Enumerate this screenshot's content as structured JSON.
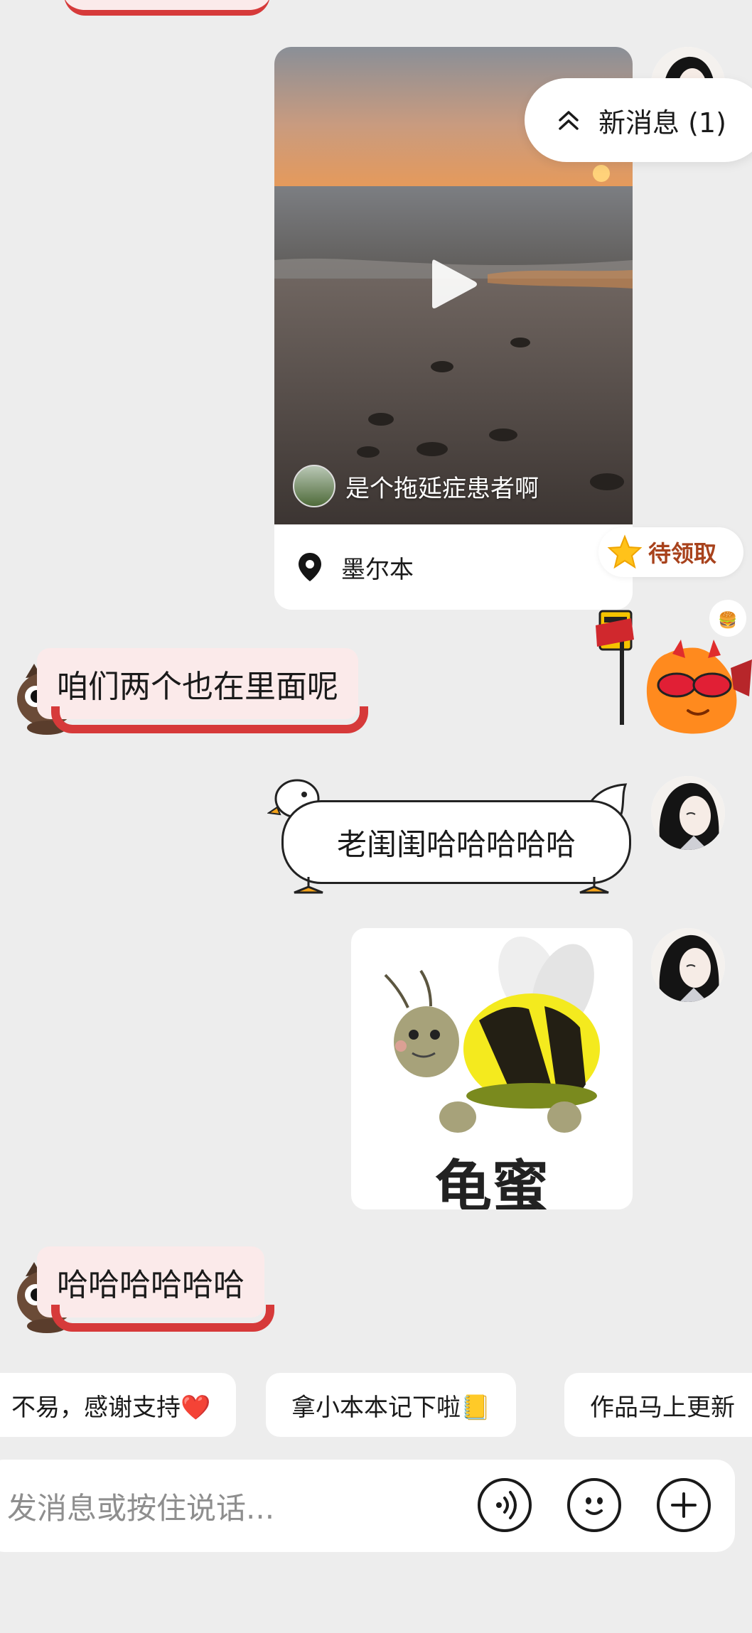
{
  "new_message": {
    "label": "新消息 (1)"
  },
  "messages": {
    "video_card": {
      "author": "是个拖延症患者啊",
      "location": "墨尔本"
    },
    "pending_reward": {
      "label": "待领取"
    },
    "pet_msg_1": "咱们两个也在里面呢",
    "goose_msg": "老闺闺哈哈哈哈哈",
    "sticker": {
      "caption": "龟蜜"
    },
    "pet_msg_2": "哈哈哈哈哈哈"
  },
  "quick_replies": [
    "不易，感谢支持❤️",
    "拿小本本记下啦📒",
    "作品马上更新"
  ],
  "input": {
    "placeholder": "发消息或按住说话..."
  },
  "icons": {
    "voice": "voice-icon",
    "emoji": "emoji-icon",
    "add": "plus-icon",
    "play": "play-icon",
    "location": "location-pin-icon",
    "star": "star-icon",
    "chevron": "chevron-up-icon"
  },
  "colors": {
    "background": "#ededed",
    "pet_bubble": "#fbeaea",
    "pet_bubble_accent": "#d63a3a",
    "pending_text": "#a8421c"
  }
}
